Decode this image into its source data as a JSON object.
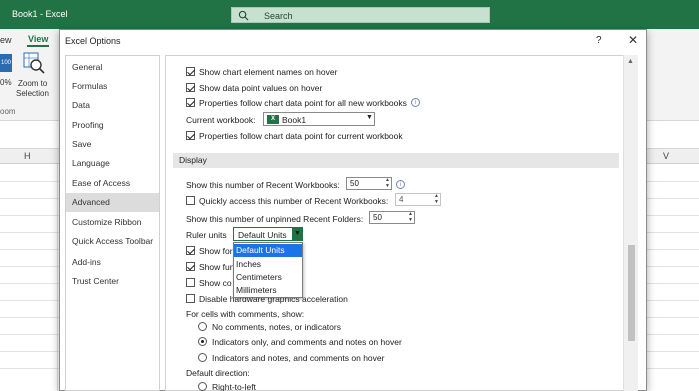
{
  "app": {
    "title": "Book1 - Excel",
    "search_label": "Search"
  },
  "ribbon": {
    "view_partial": "ew",
    "view_tab": "View",
    "zoom100_icon_text": "100",
    "zoom100_label": "0%",
    "zoom_selection_l1": "Zoom to",
    "zoom_selection_l2": "Selection",
    "group_label": "oom"
  },
  "grid": {
    "col_h": "H",
    "col_v": "V"
  },
  "dialog": {
    "title": "Excel Options",
    "help": "?",
    "close": "✕",
    "nav": [
      {
        "label": "General",
        "selected": false
      },
      {
        "label": "Formulas",
        "selected": false
      },
      {
        "label": "Data",
        "selected": false
      },
      {
        "label": "Proofing",
        "selected": false
      },
      {
        "label": "Save",
        "selected": false
      },
      {
        "label": "Language",
        "selected": false
      },
      {
        "label": "Ease of Access",
        "selected": false
      },
      {
        "label": "Advanced",
        "selected": true
      },
      {
        "label": "Customize Ribbon",
        "selected": false
      },
      {
        "label": "Quick Access Toolbar",
        "selected": false
      },
      {
        "label": "Add-ins",
        "selected": false
      },
      {
        "label": "Trust Center",
        "selected": false
      }
    ],
    "chart": {
      "names_on_hover": "Show chart element names on hover",
      "values_on_hover": "Show data point values on hover",
      "follow_all_new": "Properties follow chart data point for all new workbooks",
      "current_workbook_label": "Current workbook:",
      "current_workbook_value": "Book1",
      "follow_current": "Properties follow chart data point for current workbook"
    },
    "display": {
      "section": "Display",
      "recent_workbooks_label": "Show this number of Recent Workbooks:",
      "recent_workbooks_value": "50",
      "quick_access_label": "Quickly access this number of Recent Workbooks:",
      "quick_access_value": "4",
      "unpinned_folders_label": "Show this number of unpinned Recent Folders:",
      "unpinned_folders_value": "50",
      "ruler_units_label": "Ruler units",
      "ruler_units_value": "Default Units",
      "ruler_options": [
        "Default Units",
        "Inches",
        "Centimeters",
        "Millimeters"
      ],
      "show_for_partial": "Show for",
      "show_fun_partial": "Show fun",
      "show_co_partial": "Show co",
      "disable_hw": "Disable hardware graphics acceleration",
      "comments_label": "For cells with comments, show:",
      "no_comments": "No comments, notes, or indicators",
      "indicators_only": "Indicators only, and comments and notes on hover",
      "indicators_and": "Indicators and notes, and comments on hover",
      "default_direction": "Default direction:",
      "rtl": "Right-to-left"
    }
  }
}
